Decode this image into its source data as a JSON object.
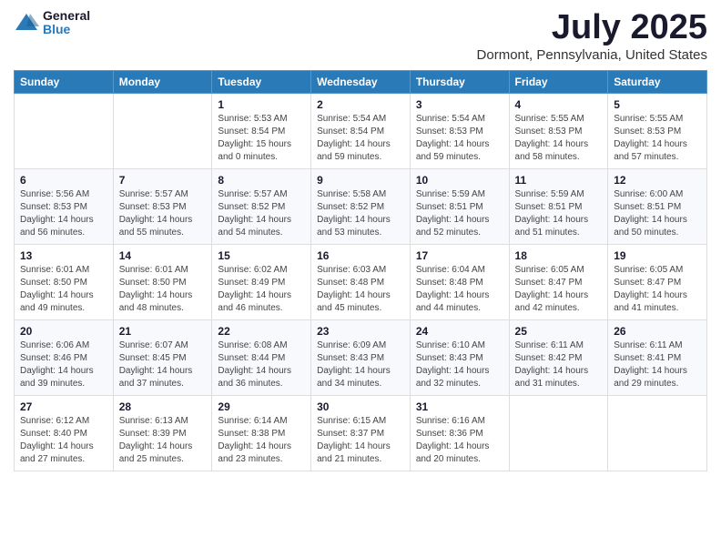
{
  "logo": {
    "general": "General",
    "blue": "Blue"
  },
  "header": {
    "month": "July 2025",
    "location": "Dormont, Pennsylvania, United States"
  },
  "weekdays": [
    "Sunday",
    "Monday",
    "Tuesday",
    "Wednesday",
    "Thursday",
    "Friday",
    "Saturday"
  ],
  "weeks": [
    [
      {
        "day": "",
        "info": ""
      },
      {
        "day": "",
        "info": ""
      },
      {
        "day": "1",
        "info": "Sunrise: 5:53 AM\nSunset: 8:54 PM\nDaylight: 15 hours and 0 minutes."
      },
      {
        "day": "2",
        "info": "Sunrise: 5:54 AM\nSunset: 8:54 PM\nDaylight: 14 hours and 59 minutes."
      },
      {
        "day": "3",
        "info": "Sunrise: 5:54 AM\nSunset: 8:53 PM\nDaylight: 14 hours and 59 minutes."
      },
      {
        "day": "4",
        "info": "Sunrise: 5:55 AM\nSunset: 8:53 PM\nDaylight: 14 hours and 58 minutes."
      },
      {
        "day": "5",
        "info": "Sunrise: 5:55 AM\nSunset: 8:53 PM\nDaylight: 14 hours and 57 minutes."
      }
    ],
    [
      {
        "day": "6",
        "info": "Sunrise: 5:56 AM\nSunset: 8:53 PM\nDaylight: 14 hours and 56 minutes."
      },
      {
        "day": "7",
        "info": "Sunrise: 5:57 AM\nSunset: 8:53 PM\nDaylight: 14 hours and 55 minutes."
      },
      {
        "day": "8",
        "info": "Sunrise: 5:57 AM\nSunset: 8:52 PM\nDaylight: 14 hours and 54 minutes."
      },
      {
        "day": "9",
        "info": "Sunrise: 5:58 AM\nSunset: 8:52 PM\nDaylight: 14 hours and 53 minutes."
      },
      {
        "day": "10",
        "info": "Sunrise: 5:59 AM\nSunset: 8:51 PM\nDaylight: 14 hours and 52 minutes."
      },
      {
        "day": "11",
        "info": "Sunrise: 5:59 AM\nSunset: 8:51 PM\nDaylight: 14 hours and 51 minutes."
      },
      {
        "day": "12",
        "info": "Sunrise: 6:00 AM\nSunset: 8:51 PM\nDaylight: 14 hours and 50 minutes."
      }
    ],
    [
      {
        "day": "13",
        "info": "Sunrise: 6:01 AM\nSunset: 8:50 PM\nDaylight: 14 hours and 49 minutes."
      },
      {
        "day": "14",
        "info": "Sunrise: 6:01 AM\nSunset: 8:50 PM\nDaylight: 14 hours and 48 minutes."
      },
      {
        "day": "15",
        "info": "Sunrise: 6:02 AM\nSunset: 8:49 PM\nDaylight: 14 hours and 46 minutes."
      },
      {
        "day": "16",
        "info": "Sunrise: 6:03 AM\nSunset: 8:48 PM\nDaylight: 14 hours and 45 minutes."
      },
      {
        "day": "17",
        "info": "Sunrise: 6:04 AM\nSunset: 8:48 PM\nDaylight: 14 hours and 44 minutes."
      },
      {
        "day": "18",
        "info": "Sunrise: 6:05 AM\nSunset: 8:47 PM\nDaylight: 14 hours and 42 minutes."
      },
      {
        "day": "19",
        "info": "Sunrise: 6:05 AM\nSunset: 8:47 PM\nDaylight: 14 hours and 41 minutes."
      }
    ],
    [
      {
        "day": "20",
        "info": "Sunrise: 6:06 AM\nSunset: 8:46 PM\nDaylight: 14 hours and 39 minutes."
      },
      {
        "day": "21",
        "info": "Sunrise: 6:07 AM\nSunset: 8:45 PM\nDaylight: 14 hours and 37 minutes."
      },
      {
        "day": "22",
        "info": "Sunrise: 6:08 AM\nSunset: 8:44 PM\nDaylight: 14 hours and 36 minutes."
      },
      {
        "day": "23",
        "info": "Sunrise: 6:09 AM\nSunset: 8:43 PM\nDaylight: 14 hours and 34 minutes."
      },
      {
        "day": "24",
        "info": "Sunrise: 6:10 AM\nSunset: 8:43 PM\nDaylight: 14 hours and 32 minutes."
      },
      {
        "day": "25",
        "info": "Sunrise: 6:11 AM\nSunset: 8:42 PM\nDaylight: 14 hours and 31 minutes."
      },
      {
        "day": "26",
        "info": "Sunrise: 6:11 AM\nSunset: 8:41 PM\nDaylight: 14 hours and 29 minutes."
      }
    ],
    [
      {
        "day": "27",
        "info": "Sunrise: 6:12 AM\nSunset: 8:40 PM\nDaylight: 14 hours and 27 minutes."
      },
      {
        "day": "28",
        "info": "Sunrise: 6:13 AM\nSunset: 8:39 PM\nDaylight: 14 hours and 25 minutes."
      },
      {
        "day": "29",
        "info": "Sunrise: 6:14 AM\nSunset: 8:38 PM\nDaylight: 14 hours and 23 minutes."
      },
      {
        "day": "30",
        "info": "Sunrise: 6:15 AM\nSunset: 8:37 PM\nDaylight: 14 hours and 21 minutes."
      },
      {
        "day": "31",
        "info": "Sunrise: 6:16 AM\nSunset: 8:36 PM\nDaylight: 14 hours and 20 minutes."
      },
      {
        "day": "",
        "info": ""
      },
      {
        "day": "",
        "info": ""
      }
    ]
  ]
}
